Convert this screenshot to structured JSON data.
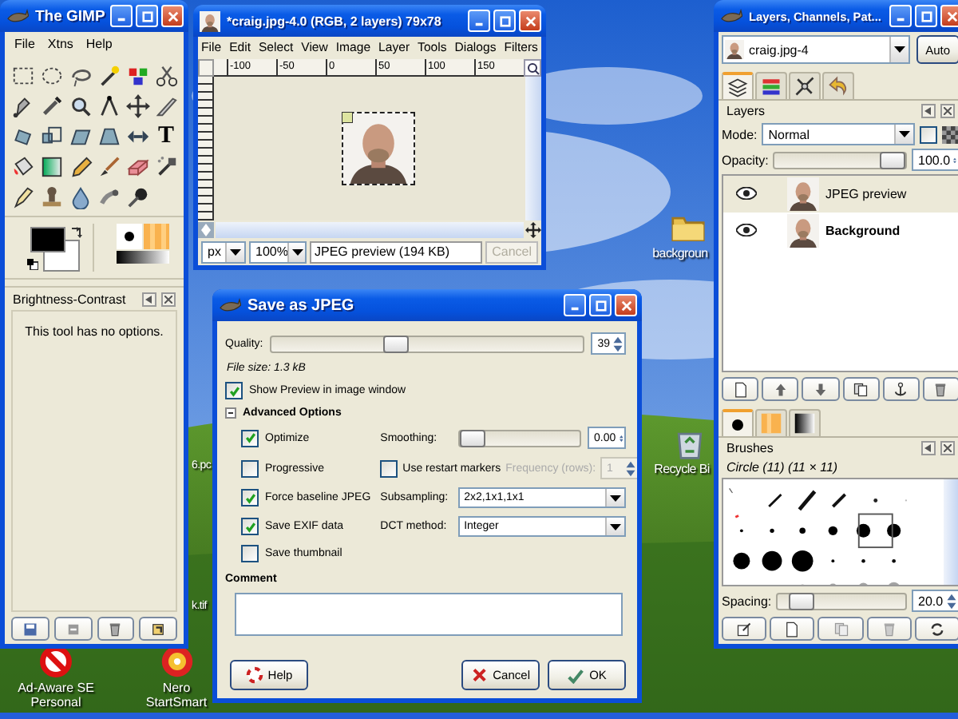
{
  "desktop": {
    "icons": [
      {
        "kind": "folder",
        "label": "backgroun"
      },
      {
        "kind": "recycle-bin",
        "label": "Recycle Bi"
      },
      {
        "kind": "ad-aware",
        "label": "Ad-Aware SE Personal"
      },
      {
        "kind": "nero",
        "label": "Nero StartSmart"
      }
    ],
    "file_labels": [
      "6.pc",
      "k.tif"
    ]
  },
  "toolbox": {
    "title": "The GIMP",
    "menu": [
      "File",
      "Xtns",
      "Help"
    ],
    "text_tool_glyph": "T",
    "tool_options": {
      "title": "Brightness-Contrast",
      "message": "This tool has no options."
    }
  },
  "image_window": {
    "title": "*craig.jpg-4.0 (RGB, 2 layers) 79x78",
    "menu": [
      "File",
      "Edit",
      "Select",
      "View",
      "Image",
      "Layer",
      "Tools",
      "Dialogs",
      "Filters"
    ],
    "ruler_labels": [
      "-100",
      "-50",
      "0",
      "50",
      "100",
      "150"
    ],
    "unit": "px",
    "zoom": "100%",
    "status": "JPEG preview (194 KB)",
    "cancel": {
      "label": "Cancel",
      "disabled": true
    }
  },
  "layers_window": {
    "title": "Layers, Channels, Pat...",
    "image": "craig.jpg-4",
    "auto_button": "Auto",
    "tabs": [
      {
        "kind": "layers",
        "selected": true
      },
      {
        "kind": "channels",
        "selected": false
      },
      {
        "kind": "paths",
        "selected": false
      },
      {
        "kind": "undo",
        "selected": false
      }
    ],
    "layers_panel": {
      "title": "Layers",
      "mode_label": "Mode:",
      "mode": "Normal",
      "lock_checkbox": {
        "checked": false
      },
      "opacity_label": "Opacity:",
      "opacity": {
        "level": 1,
        "reading": "100.0"
      },
      "layers": [
        {
          "name": "JPEG preview",
          "selected": true,
          "visible": true,
          "bold": false
        },
        {
          "name": "Background",
          "selected": false,
          "visible": true,
          "bold": true
        }
      ]
    },
    "brush_tabs": [
      {
        "kind": "brushes",
        "selected": true
      },
      {
        "kind": "patterns",
        "selected": false
      },
      {
        "kind": "gradients",
        "selected": false
      }
    ],
    "brushes_panel": {
      "title": "Brushes",
      "current": "Circle (11) (11 × 11)",
      "spacing_label": "Spacing:",
      "spacing": {
        "level": 0.1,
        "reading": "20.0"
      }
    }
  },
  "save_dialog": {
    "title": "Save as JPEG",
    "quality_label": "Quality:",
    "quality": {
      "level": 0.39,
      "reading": "39"
    },
    "file_size": "File size: 1.3 kB",
    "show_preview": {
      "label": "Show Preview in image window",
      "checked": true
    },
    "advanced": {
      "label": "Advanced Options",
      "expanded": true
    },
    "options": [
      {
        "label": "Optimize",
        "checked": true
      },
      {
        "label": "Progressive",
        "checked": false
      },
      {
        "label": "Force baseline JPEG",
        "checked": true
      },
      {
        "label": "Save EXIF data",
        "checked": true
      },
      {
        "label": "Save thumbnail",
        "checked": false
      }
    ],
    "smoothing": {
      "label": "Smoothing:",
      "level": 0,
      "reading": "0.00"
    },
    "restart_markers": {
      "label": "Use restart markers",
      "checked": false
    },
    "frequency": {
      "label": "Frequency (rows):",
      "value": "1",
      "disabled": true
    },
    "subsampling": {
      "label": "Subsampling:",
      "value": "2x2,1x1,1x1"
    },
    "dct_method": {
      "label": "DCT method:",
      "value": "Integer"
    },
    "comment_label": "Comment",
    "buttons": [
      {
        "kind": "help",
        "label": "Help"
      },
      {
        "kind": "cancel",
        "label": "Cancel"
      },
      {
        "kind": "ok",
        "label": "OK"
      }
    ]
  }
}
